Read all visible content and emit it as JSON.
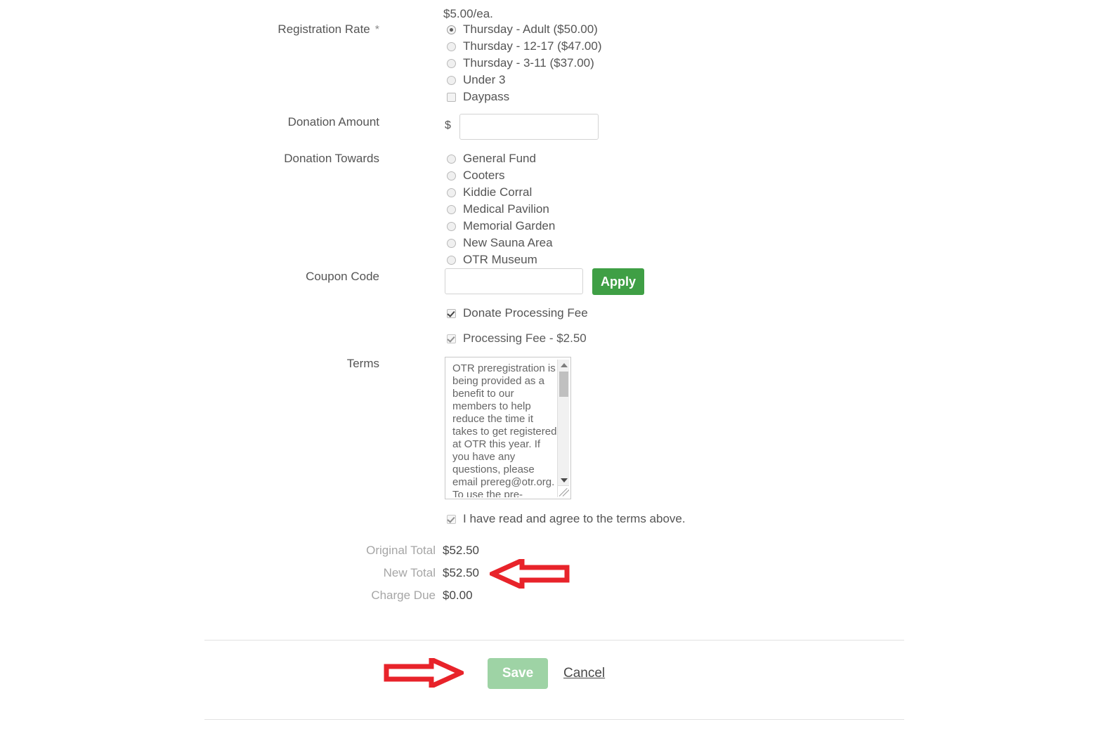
{
  "form": {
    "registration_rate": {
      "label": "Registration Rate",
      "required_marker": "*",
      "price_note": "$5.00/ea.",
      "options": [
        {
          "text": "Thursday - Adult ($50.00)",
          "type": "radio",
          "selected": true
        },
        {
          "text": "Thursday - 12-17 ($47.00)",
          "type": "radio",
          "selected": false
        },
        {
          "text": "Thursday - 3-11 ($37.00)",
          "type": "radio",
          "selected": false
        },
        {
          "text": "Under 3",
          "type": "radio",
          "selected": false
        },
        {
          "text": "Daypass",
          "type": "checkbox",
          "selected": false
        }
      ]
    },
    "donation_amount": {
      "label": "Donation Amount",
      "currency_prefix": "$",
      "value": "",
      "placeholder": ""
    },
    "donation_towards": {
      "label": "Donation Towards",
      "options": [
        {
          "text": "General Fund",
          "selected": false
        },
        {
          "text": "Cooters",
          "selected": false
        },
        {
          "text": "Kiddie Corral",
          "selected": false
        },
        {
          "text": "Medical Pavilion",
          "selected": false
        },
        {
          "text": "Memorial Garden",
          "selected": false
        },
        {
          "text": "New Sauna Area",
          "selected": false
        },
        {
          "text": "OTR Museum",
          "selected": false
        }
      ]
    },
    "coupon_code": {
      "label": "Coupon Code",
      "value": "",
      "placeholder": "",
      "apply_label": "Apply"
    },
    "fees": [
      {
        "text": "Donate Processing Fee",
        "checked": true,
        "disabled": false
      },
      {
        "text": "Processing Fee - $2.50",
        "checked": true,
        "disabled": true
      }
    ],
    "terms": {
      "label": "Terms",
      "body": "OTR preregistration is being provided as a benefit to our members to help reduce the time it takes to get registered at OTR this year. If you have any questions, please email prereg@otr.org. To use the pre-registration",
      "agree": {
        "text": "I have read and agree to the terms above.",
        "checked": true,
        "disabled": true
      }
    },
    "totals": [
      {
        "label": "Original Total",
        "value": "$52.50"
      },
      {
        "label": "New Total",
        "value": "$52.50"
      },
      {
        "label": "Charge Due",
        "value": "$0.00"
      }
    ],
    "actions": {
      "save_label": "Save",
      "cancel_label": "Cancel"
    }
  },
  "annotations": [
    {
      "name": "new-total-arrow",
      "direction": "left"
    },
    {
      "name": "save-button-arrow",
      "direction": "right"
    }
  ],
  "colors": {
    "apply_green": "#3f9f45",
    "save_green_disabled": "#9ed3a5",
    "annotation_red": "#e8232a",
    "label_gray": "#555555",
    "total_label_gray": "#a6a6a6"
  }
}
